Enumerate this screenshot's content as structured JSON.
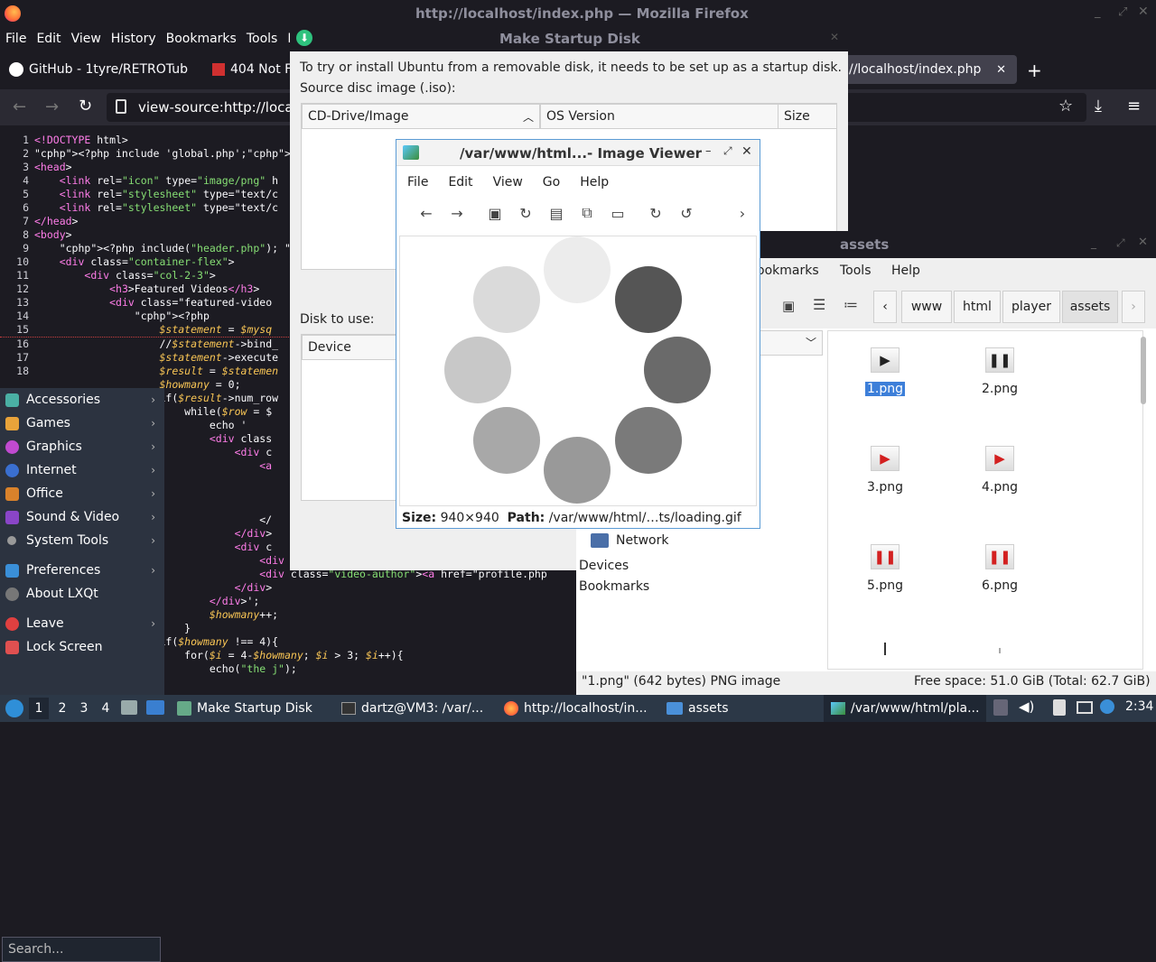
{
  "firefox": {
    "title": "http://localhost/index.php — Mozilla Firefox",
    "menu": [
      "File",
      "Edit",
      "View",
      "History",
      "Bookmarks",
      "Tools",
      "H"
    ],
    "tabs": [
      "GitHub - 1tyre/RETROTub",
      "404 Not F",
      "//localhost/index.php"
    ],
    "url": "view-source:http://locall"
  },
  "code_lines": [
    {
      "n": "1",
      "t": "<!DOCTYPE html>"
    },
    {
      "n": "2",
      "t": "<?php include 'global.php';?>"
    },
    {
      "n": "3",
      "t": "<head>"
    },
    {
      "n": "4",
      "t": "    <link rel=\"icon\" type=\"image/png\" h"
    },
    {
      "n": "5",
      "t": "    <link rel=\"stylesheet\" type=\"text/c"
    },
    {
      "n": "6",
      "t": "    <link rel=\"stylesheet\" type=\"text/c"
    },
    {
      "n": "7",
      "t": "</head>"
    },
    {
      "n": "8",
      "t": "<body>"
    },
    {
      "n": "9",
      "t": "    <?php include(\"header.php\"); ?>"
    },
    {
      "n": "10",
      "t": "    <div class=\"container-flex\">"
    },
    {
      "n": "11",
      "t": "        <div class=\"col-2-3\">"
    },
    {
      "n": "12",
      "t": "            <h3>Featured Videos</h3>"
    },
    {
      "n": "13",
      "t": "            <div class=\"featured-video"
    },
    {
      "n": "14",
      "t": "                <?php"
    },
    {
      "n": "15",
      "t": "                    $statement = $mysq"
    },
    {
      "n": "16",
      "t": "                    //$statement->bind_"
    },
    {
      "n": "17",
      "t": "                    $statement->execute"
    },
    {
      "n": "18",
      "t": "                    $result = $statemen"
    },
    {
      "n": "",
      "t": "                    $howmany = 0;"
    },
    {
      "n": "",
      "t": "                    if($result->num_row"
    },
    {
      "n": "",
      "t": "                        while($row = $"
    },
    {
      "n": "",
      "t": "                            echo '"
    },
    {
      "n": "",
      "t": "                            <div class"
    },
    {
      "n": "",
      "t": "                                <div c"
    },
    {
      "n": "",
      "t": "                                    <a"
    },
    {
      "n": "",
      "t": ""
    },
    {
      "n": "",
      "t": ""
    },
    {
      "n": "",
      "t": ""
    },
    {
      "n": "",
      "t": "                                    </"
    },
    {
      "n": "",
      "t": "                                </div>"
    },
    {
      "n": "",
      "t": "                                <div c"
    },
    {
      "n": "",
      "t": "                                    <div class=\"video-title\"><a href=\"viewvideo.php"
    },
    {
      "n": "",
      "t": "                                    <div class=\"video-author\"><a href=\"profile.php"
    },
    {
      "n": "",
      "t": "                                </div>"
    },
    {
      "n": "",
      "t": "                            </div>';"
    },
    {
      "n": "",
      "t": "                            $howmany++;"
    },
    {
      "n": "",
      "t": "                        }"
    },
    {
      "n": "",
      "t": "                    if($howmany !== 4){"
    },
    {
      "n": "",
      "t": "                        for($i = 4-$howmany; $i > 3; $i++){"
    },
    {
      "n": "",
      "t": "                            echo(\"the j\");"
    }
  ],
  "lxqt_menu": {
    "items": [
      "Accessories",
      "Games",
      "Graphics",
      "Internet",
      "Office",
      "Sound & Video",
      "System Tools"
    ],
    "items2": [
      "Preferences",
      "About LXQt"
    ],
    "items3": [
      "Leave",
      "Lock Screen"
    ],
    "search_placeholder": "Search..."
  },
  "startup_disk": {
    "title": "Make Startup Disk",
    "intro": "To try or install Ubuntu from a removable disk, it needs to be set up as a startup disk.",
    "source_label": "Source disc image (.iso):",
    "cols": [
      "CD-Drive/Image",
      "OS Version",
      "Size"
    ],
    "disk_label": "Disk to use:",
    "disk_col": "Device"
  },
  "image_viewer": {
    "title": "/var/www/html...- Image Viewer",
    "menu": [
      "File",
      "Edit",
      "View",
      "Go",
      "Help"
    ],
    "size_label": "Size:",
    "size": "940×940",
    "path_label": "Path:",
    "path": "/var/www/html/…ts/loading.gif"
  },
  "file_manager": {
    "title": "assets",
    "menu": [
      "ookmarks",
      "Tools",
      "Help"
    ],
    "crumbs": [
      "www",
      "html",
      "player",
      "assets"
    ],
    "side": {
      "network": "Network",
      "devices": "Devices",
      "bookmarks": "Bookmarks"
    },
    "files": [
      "1.png",
      "2.png",
      "3.png",
      "4.png",
      "5.png",
      "6.png"
    ],
    "status_left": "\"1.png\" (642 bytes) PNG image",
    "status_right": "Free space: 51.0 GiB (Total: 62.7 GiB)"
  },
  "taskbar": {
    "desktops": [
      "1",
      "2",
      "3",
      "4"
    ],
    "tasks": [
      "Make Startup Disk",
      "dartz@VM3: /var/...",
      "http://localhost/in...",
      "assets",
      "/var/www/html/pla..."
    ],
    "clock": "2:34"
  }
}
